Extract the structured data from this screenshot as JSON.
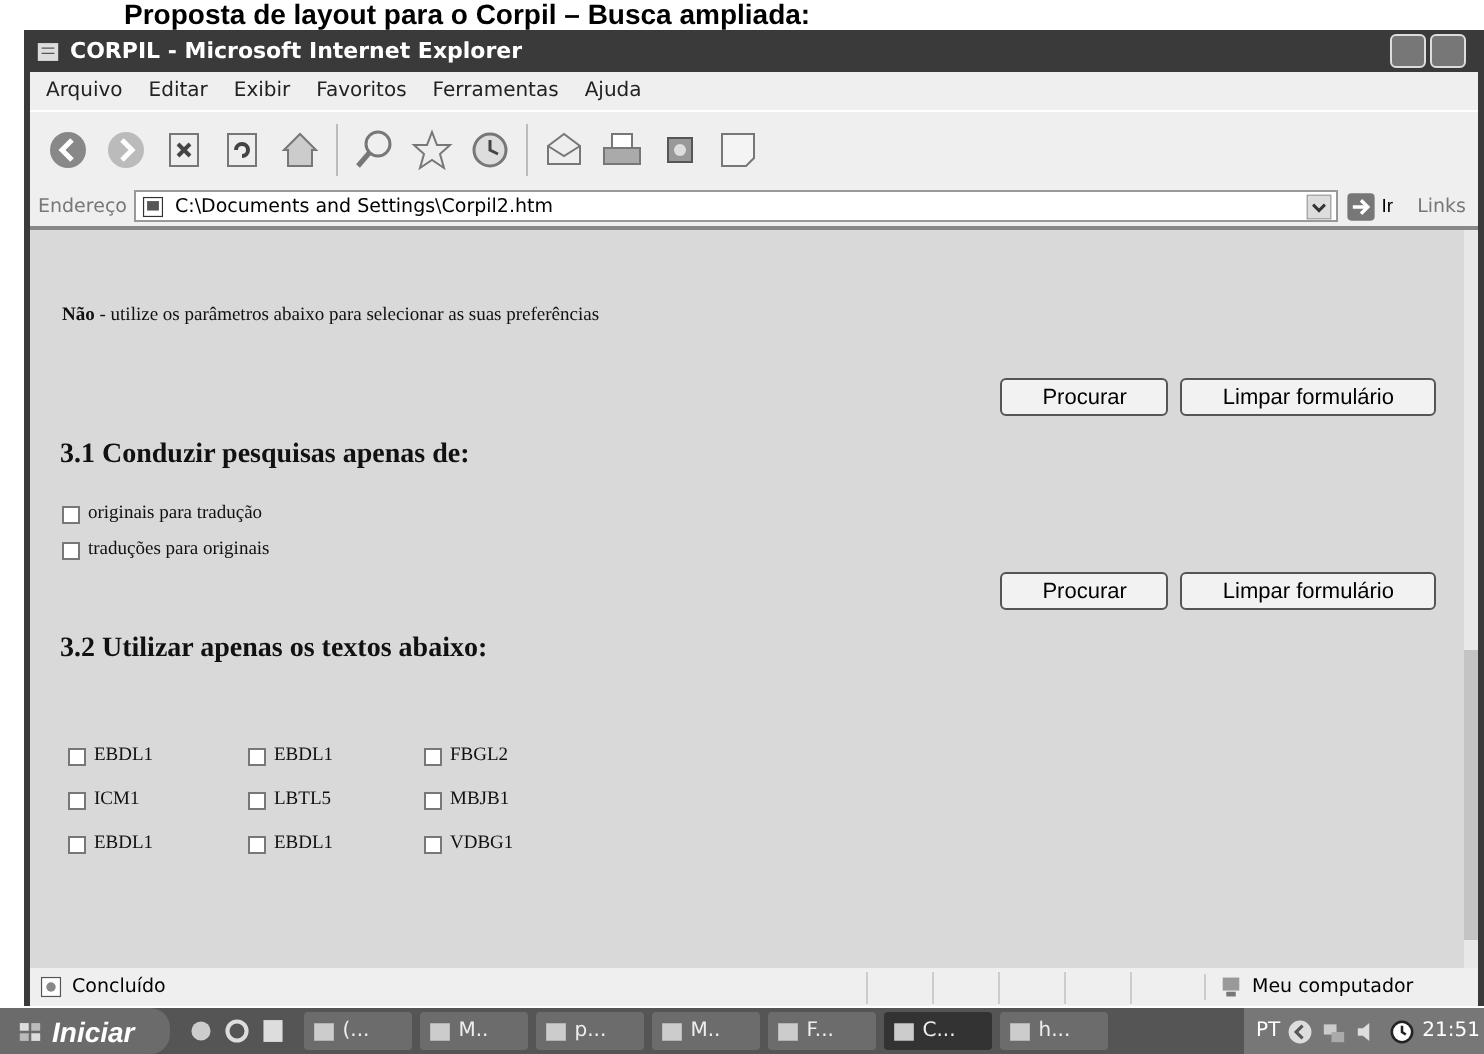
{
  "caption": "Proposta de layout para o Corpil – Busca ampliada:",
  "window": {
    "title": "CORPIL - Microsoft Internet Explorer",
    "menu": [
      "Arquivo",
      "Editar",
      "Exibir",
      "Favoritos",
      "Ferramentas",
      "Ajuda"
    ],
    "address": {
      "label": "Endereço",
      "value": "C:\\Documents and Settings\\Corpil2.htm",
      "go": "Ir",
      "links": "Links"
    },
    "content": {
      "intro": {
        "text": "**Não** - utilize os parâmetros abaixo para selecionar as suas preferências",
        "buttons": [
          "Procurar",
          "Limpar formulário"
        ]
      },
      "sections": [
        {
          "title": "3.1 Conduzir pesquisas apenas de:",
          "kind": "list",
          "options": [
            {
              "label": "originais para tradução",
              "checked": false
            },
            {
              "label": "traduções para originais",
              "checked": false
            }
          ],
          "buttons": [
            "Procurar",
            "Limpar formulário"
          ]
        },
        {
          "title": "3.2 Utilizar apenas os textos abaixo:",
          "kind": "grid",
          "options": [
            {
              "label": "EBDL1",
              "checked": false
            },
            {
              "label": "EBDL1",
              "checked": false
            },
            {
              "label": "FBGL2",
              "checked": false
            },
            {
              "label": "ICM1",
              "checked": false
            },
            {
              "label": "LBTL5",
              "checked": false
            },
            {
              "label": "MBJB1",
              "checked": false
            },
            {
              "label": "EBDL1",
              "checked": false
            },
            {
              "label": "EBDL1",
              "checked": false
            },
            {
              "label": "VDBG1",
              "checked": false
            }
          ]
        }
      ]
    },
    "status": {
      "text": "Concluído",
      "zone": "Meu computador"
    }
  },
  "taskbar": {
    "start": "Iniciar",
    "tasks": [
      {
        "label": "(...",
        "selected": false
      },
      {
        "label": "M..",
        "selected": false
      },
      {
        "label": "p...",
        "selected": false
      },
      {
        "label": "M..",
        "selected": false
      },
      {
        "label": "F...",
        "selected": false
      },
      {
        "label": "C...",
        "selected": true
      },
      {
        "label": "h...",
        "selected": false
      }
    ],
    "tray": {
      "lang": "PT",
      "time": "21:51"
    }
  }
}
